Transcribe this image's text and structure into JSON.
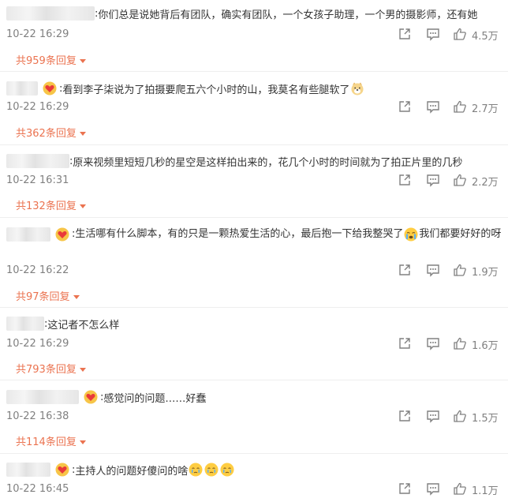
{
  "comments": [
    {
      "text": "你们总是说她背后有团队，确实有团队，一个女孩子助理，一个男的摄影师，还有她",
      "time": "10-22 16:29",
      "likes": "4.5万",
      "replies": "共959条回复",
      "has_badge": false
    },
    {
      "text": "看到李子柒说为了拍摄要爬五六个小时的山，我莫名有些腿软了",
      "time": "10-22 16:29",
      "likes": "2.7万",
      "replies": "共362条回复",
      "has_badge": true
    },
    {
      "text": "原来视频里短短几秒的星空是这样拍出来的，花几个小时的时间就为了拍正片里的几秒",
      "time": "10-22 16:31",
      "likes": "2.2万",
      "replies": "共132条回复",
      "has_badge": false
    },
    {
      "text_a": "生活哪有什么脚本，有的只是一颗热爱生活的心，最后抱一下给我整哭了",
      "text_b": "我们都要好好的呀",
      "time": "10-22 16:22",
      "likes": "1.9万",
      "replies": "共97条回复",
      "has_badge": true
    },
    {
      "text": "这记者不怎么样",
      "time": "10-22 16:29",
      "likes": "1.6万",
      "replies": "共793条回复",
      "has_badge": false
    },
    {
      "text": "感觉问的问题……好蠢",
      "time": "10-22 16:38",
      "likes": "1.5万",
      "replies": "共114条回复",
      "has_badge": true
    },
    {
      "text": "主持人的问题好傻问的啥",
      "time": "10-22 16:45",
      "likes": "1.1万",
      "has_badge": true
    }
  ],
  "colon": ":",
  "icons": {
    "share": "share-icon",
    "comment": "comment-icon",
    "like": "thumbs-up-icon",
    "badge": "vip-heart-badge-icon",
    "dog": "dog-face-emoji",
    "crying": "crying-face-emoji",
    "sob": "sobbing-face-emoji"
  },
  "colors": {
    "accent": "#eb7350",
    "meta_gray": "#808080",
    "text": "#333333"
  }
}
